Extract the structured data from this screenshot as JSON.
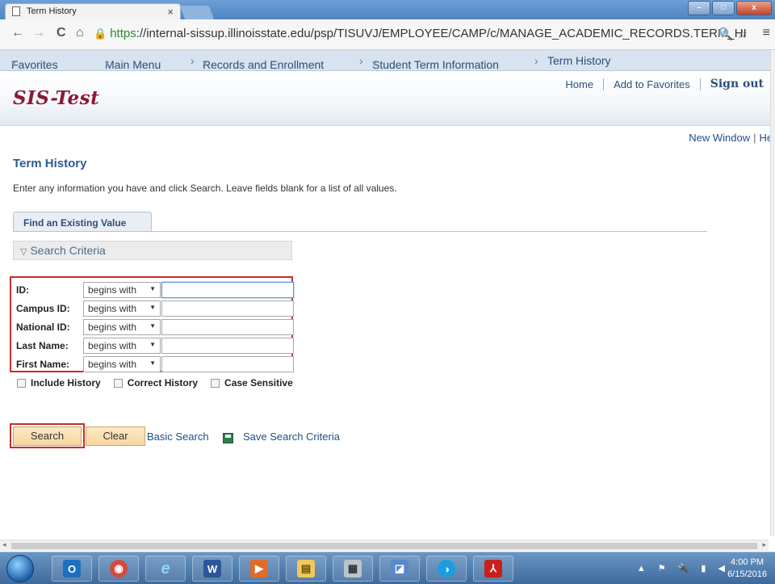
{
  "browser": {
    "tab_title": "Term History",
    "tab_close": "×",
    "url_prefix": "https",
    "url_rest": "://internal-sissup.illinoisstate.edu/psp/TISUVJ/EMPLOYEE/CAMP/c/MANAGE_ACADEMIC_RECORDS.TERM_HI",
    "back": "←",
    "forward": "→",
    "reload": "C",
    "home": "⌂",
    "lock": "🔒",
    "zoom_star": "🔍 ☆",
    "menu": "≡",
    "win_min": "–",
    "win_max": "□",
    "win_close": "x"
  },
  "ps_nav": {
    "favorites": "Favorites",
    "main_menu": "Main Menu",
    "records": "Records and Enrollment",
    "student_term": "Student Term Information",
    "term_history": "Term History",
    "caret": "▾",
    "sep": "›"
  },
  "header": {
    "logo": "SIS-Test",
    "home": "Home",
    "add_favorites": "Add to Favorites",
    "sign_out": "Sign out"
  },
  "right_links": {
    "new_window": "New Window",
    "help": "Hel"
  },
  "page": {
    "title": "Term History",
    "instructions": "Enter any information you have and click Search. Leave fields blank for a list of all values.",
    "tab_label": "Find an Existing Value",
    "criteria_label": "Search Criteria",
    "criteria_tri": "▽"
  },
  "fields": [
    {
      "label": "ID:",
      "operator": "begins with",
      "value": ""
    },
    {
      "label": "Campus ID:",
      "operator": "begins with",
      "value": ""
    },
    {
      "label": "National ID:",
      "operator": "begins with",
      "value": ""
    },
    {
      "label": "Last Name:",
      "operator": "begins with",
      "value": ""
    },
    {
      "label": "First Name:",
      "operator": "begins with",
      "value": ""
    }
  ],
  "select_arrow": "▼",
  "checkboxes": {
    "include_history": "Include History",
    "correct_history": "Correct History",
    "case_sensitive": "Case Sensitive"
  },
  "actions": {
    "search": "Search",
    "clear": "Clear",
    "basic_search": "Basic Search",
    "save_criteria": "Save Search Criteria"
  },
  "scroll": {
    "left": "◂",
    "right": "▸"
  },
  "taskbar": {
    "tray": "▲ ⚑ 🔌 ▮ ◀",
    "time": "4:00 PM",
    "date": "6/15/2016",
    "apps": [
      "O",
      "◉",
      "e",
      "W",
      "▶",
      "▤",
      "▦",
      "◪",
      "◑",
      "⅄"
    ]
  },
  "colors": {
    "accent_red": "#cc2b2b",
    "link_blue": "#1f4f86",
    "logo_maroon": "#8b1a36",
    "button_peach": "#f6d7a0"
  }
}
